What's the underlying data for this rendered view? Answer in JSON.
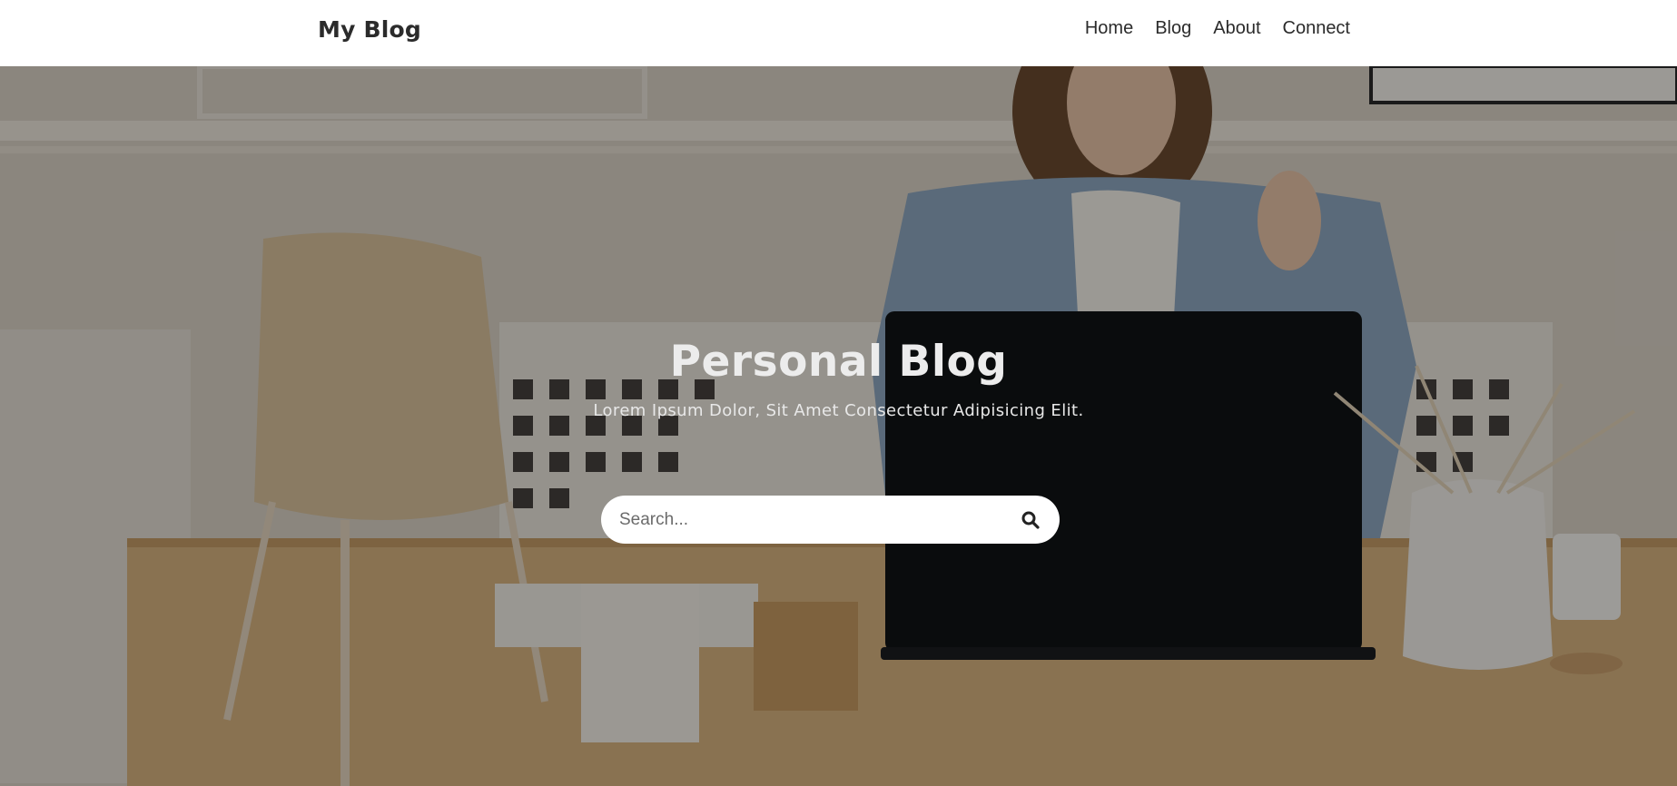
{
  "header": {
    "brand": "My Blog",
    "nav": [
      "Home",
      "Blog",
      "About",
      "Connect"
    ]
  },
  "hero": {
    "title": "Personal Blog",
    "subtitle": "Lorem Ipsum Dolor, Sit Amet Consectetur Adipisicing Elit.",
    "background_image": "woman-at-desk-with-laptop-photo"
  },
  "search": {
    "placeholder": "Search...",
    "value": "",
    "icon": "search-icon"
  },
  "colors": {
    "navbar_bg": "#ffffff",
    "text_dark": "#2b2b2b",
    "hero_text": "#ececec"
  }
}
